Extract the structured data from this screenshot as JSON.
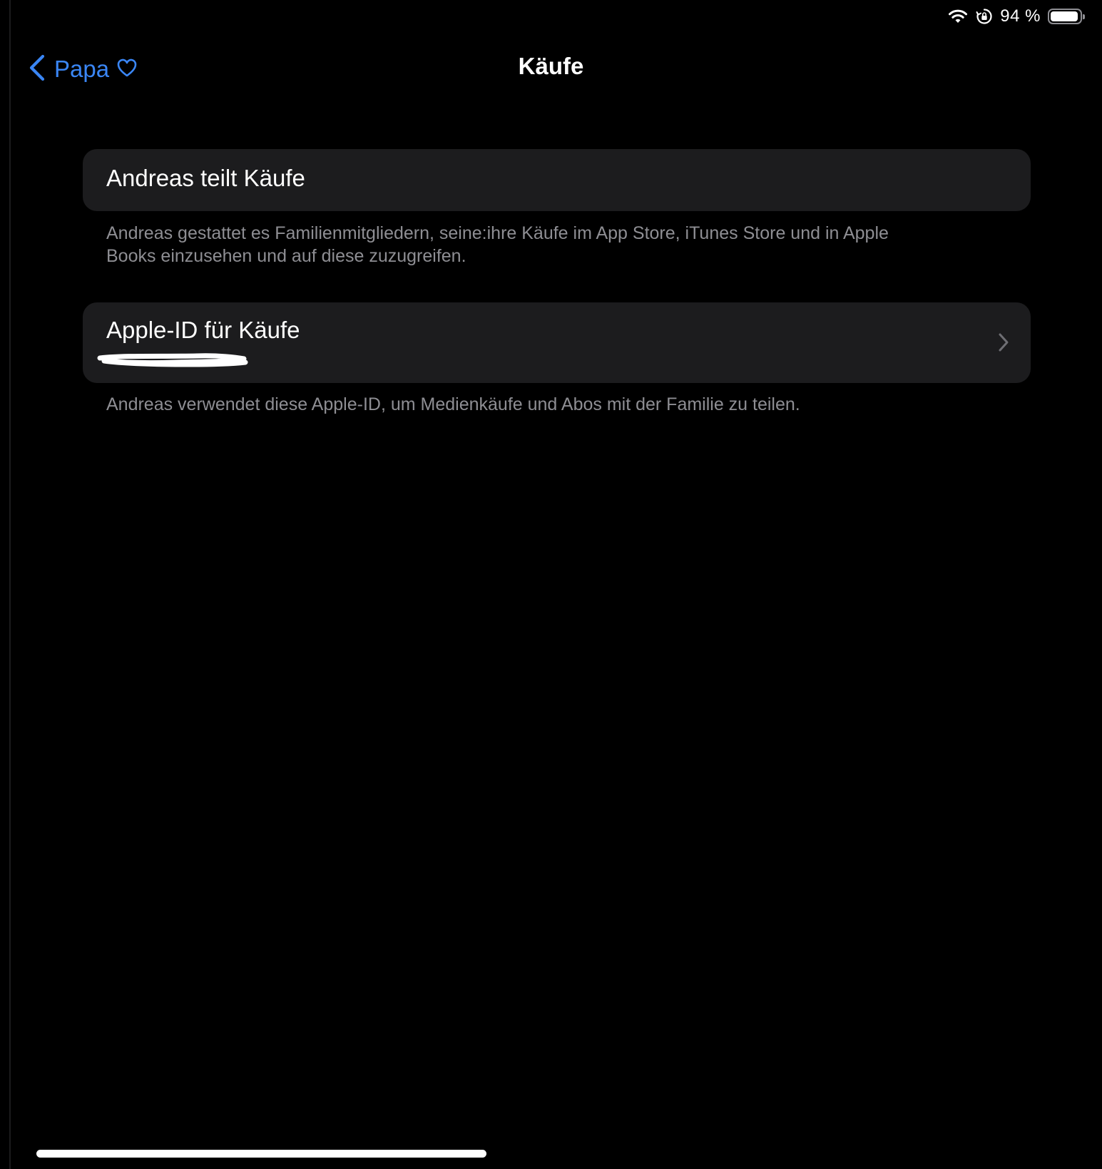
{
  "status_bar": {
    "battery_percent": "94 %",
    "battery_level": 0.94,
    "icons": [
      "wifi-icon",
      "orientation-lock-icon",
      "battery-icon"
    ]
  },
  "nav": {
    "back_label": "Papa",
    "back_icons": [
      "chevron-left-icon",
      "heart-icon"
    ],
    "title": "Käufe"
  },
  "sharing_cell": {
    "label": "Andreas teilt Käufe",
    "footer": "Andreas gestattet es Familienmitgliedern, seine:ihre Käufe im App Store, iTunes Store und in Apple Books einzusehen und auf diese zuzugreifen."
  },
  "apple_id_cell": {
    "label": "Apple-ID für Käufe",
    "footer": "Andreas verwendet diese Apple-ID, um Medienkäufe und Abos mit der Familie zu teilen."
  },
  "colors": {
    "accent": "#3a86f5",
    "background": "#000000",
    "cell_background": "#1c1c1e",
    "secondary_text": "#8e8e93"
  }
}
